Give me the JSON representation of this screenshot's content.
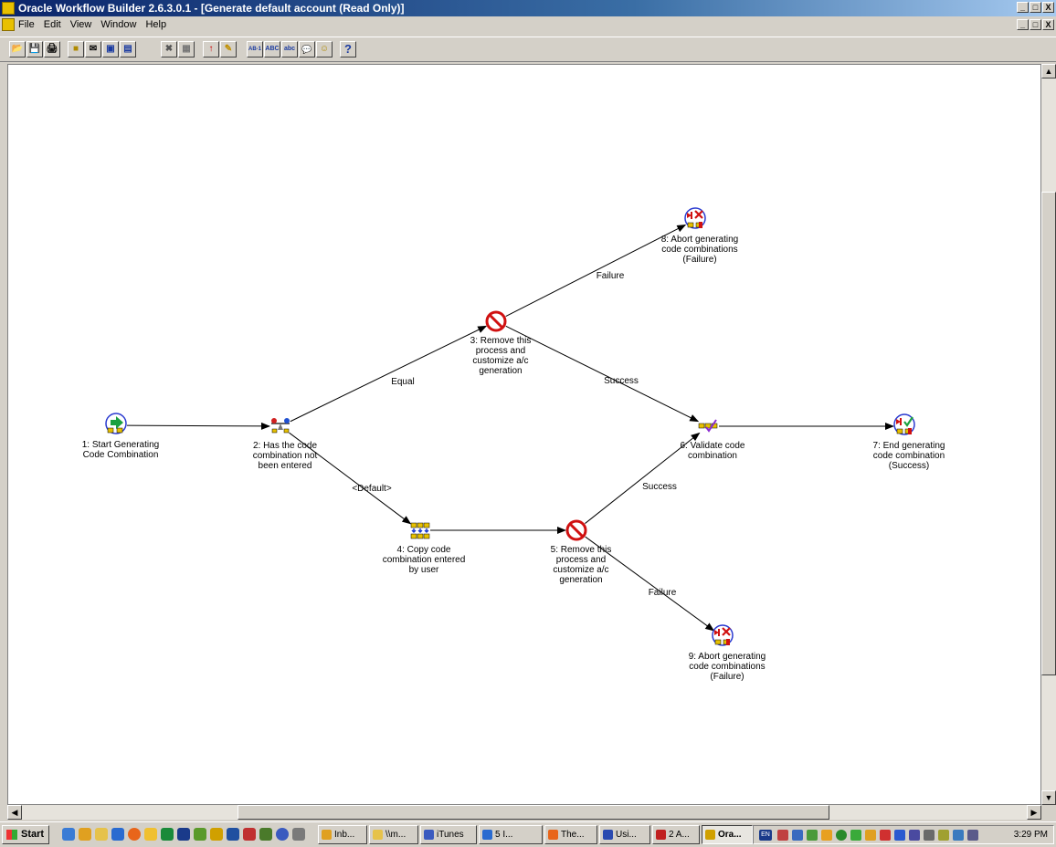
{
  "window": {
    "title": "Oracle Workflow Builder 2.6.3.0.1 - [Generate default account (Read Only)]",
    "controls": [
      "_",
      "□",
      "X"
    ]
  },
  "menu": [
    "File",
    "Edit",
    "View",
    "Window",
    "Help"
  ],
  "toolbar": [
    {
      "name": "open-button",
      "glyph": "📂"
    },
    {
      "name": "save-button",
      "glyph": "💾"
    },
    {
      "name": "print-button",
      "glyph": "🖨"
    },
    {
      "name": "new-item-button",
      "glyph": "■"
    },
    {
      "name": "new-message-button",
      "glyph": "✉"
    },
    {
      "name": "new-lookup-button",
      "glyph": "▣"
    },
    {
      "name": "new-function-button",
      "glyph": "▤"
    },
    {
      "name": "delete-button",
      "glyph": "✖"
    },
    {
      "name": "properties-button",
      "glyph": "▦"
    },
    {
      "name": "arrow-tool-button",
      "glyph": "↑"
    },
    {
      "name": "pencil-tool-button",
      "glyph": "✎"
    },
    {
      "name": "label-ab1-button",
      "glyph": "AB-1"
    },
    {
      "name": "label-abc-upper-button",
      "glyph": "ABC"
    },
    {
      "name": "label-abc-lower-button",
      "glyph": "abc"
    },
    {
      "name": "comment-button",
      "glyph": "💬"
    },
    {
      "name": "smile-button",
      "glyph": "☺"
    },
    {
      "name": "help-button",
      "glyph": "?"
    }
  ],
  "diagram": {
    "nodes": [
      {
        "id": "n1",
        "icon": "start-process-icon",
        "lines": [
          "1: Start Generating",
          "Code Combination"
        ]
      },
      {
        "id": "n2",
        "icon": "compare-function-icon",
        "lines": [
          "2: Has the code",
          "combination not",
          "been entered"
        ]
      },
      {
        "id": "n3",
        "icon": "prohibited-icon",
        "lines": [
          "3: Remove this",
          "process and",
          "customize a/c",
          "generation"
        ]
      },
      {
        "id": "n4",
        "icon": "copy-combination-icon",
        "lines": [
          "4: Copy code",
          "combination entered",
          "by user"
        ]
      },
      {
        "id": "n5",
        "icon": "prohibited-icon",
        "lines": [
          "5: Remove this",
          "process and",
          "customize a/c",
          "generation"
        ]
      },
      {
        "id": "n6",
        "icon": "validate-check-icon",
        "lines": [
          "6: Validate code",
          "combination"
        ]
      },
      {
        "id": "n7",
        "icon": "end-success-icon",
        "lines": [
          "7: End generating",
          "code combination",
          "(Success)"
        ]
      },
      {
        "id": "n8",
        "icon": "abort-failure-icon",
        "lines": [
          "8: Abort generating",
          "code combinations",
          "(Failure)"
        ]
      },
      {
        "id": "n9",
        "icon": "abort-failure-icon",
        "lines": [
          "9: Abort generating",
          "code combinations",
          "(Failure)"
        ]
      }
    ],
    "transitions": [
      {
        "from": "n1",
        "to": "n2",
        "label": ""
      },
      {
        "from": "n2",
        "to": "n3",
        "label": "Equal"
      },
      {
        "from": "n2",
        "to": "n4",
        "label": "<Default>"
      },
      {
        "from": "n3",
        "to": "n8",
        "label": "Failure"
      },
      {
        "from": "n3",
        "to": "n6",
        "label": "Success"
      },
      {
        "from": "n4",
        "to": "n5",
        "label": ""
      },
      {
        "from": "n5",
        "to": "n6",
        "label": "Success"
      },
      {
        "from": "n5",
        "to": "n9",
        "label": "Failure"
      },
      {
        "from": "n6",
        "to": "n7",
        "label": ""
      }
    ]
  },
  "taskbar": {
    "start_label": "Start",
    "tasks": [
      "Inb...",
      "\\\\m...",
      "iTunes",
      "5 I...",
      "The...",
      "Usi...",
      "2 A...",
      "Ora..."
    ],
    "active_task": "Ora...",
    "tray_lang": "EN",
    "clock": "3:29 PM"
  }
}
